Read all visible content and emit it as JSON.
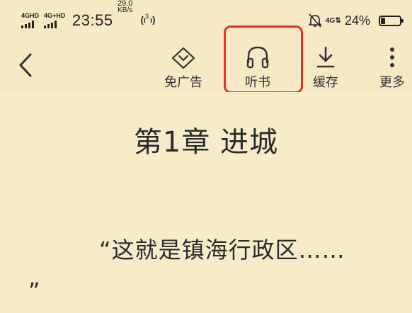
{
  "status_bar": {
    "signal1_label": "4GHD",
    "signal2_label": "4G+HD",
    "time": "23:55",
    "net_speed_value": "29.0",
    "net_speed_unit": "KB/s",
    "hotspot_badge": "3",
    "data_indicator": "4G⇅",
    "battery_percent": "24%",
    "battery_level": 0.24
  },
  "toolbar": {
    "back_icon": "chevron-left-icon",
    "items": [
      {
        "id": "no-ads",
        "label": "免广告",
        "icon": "diamond-chevron-icon"
      },
      {
        "id": "listen",
        "label": "听书",
        "icon": "headphones-icon"
      },
      {
        "id": "cache",
        "label": "缓存",
        "icon": "download-icon"
      },
      {
        "id": "more",
        "label": "更多",
        "icon": "more-vertical-icon"
      }
    ],
    "highlight_color": "#e0322b"
  },
  "reader": {
    "chapter_title": "第1章 进城",
    "paragraph_start": "“这就是镇海行政区……",
    "paragraph_end": "”",
    "background_color": "#f7ecca"
  }
}
